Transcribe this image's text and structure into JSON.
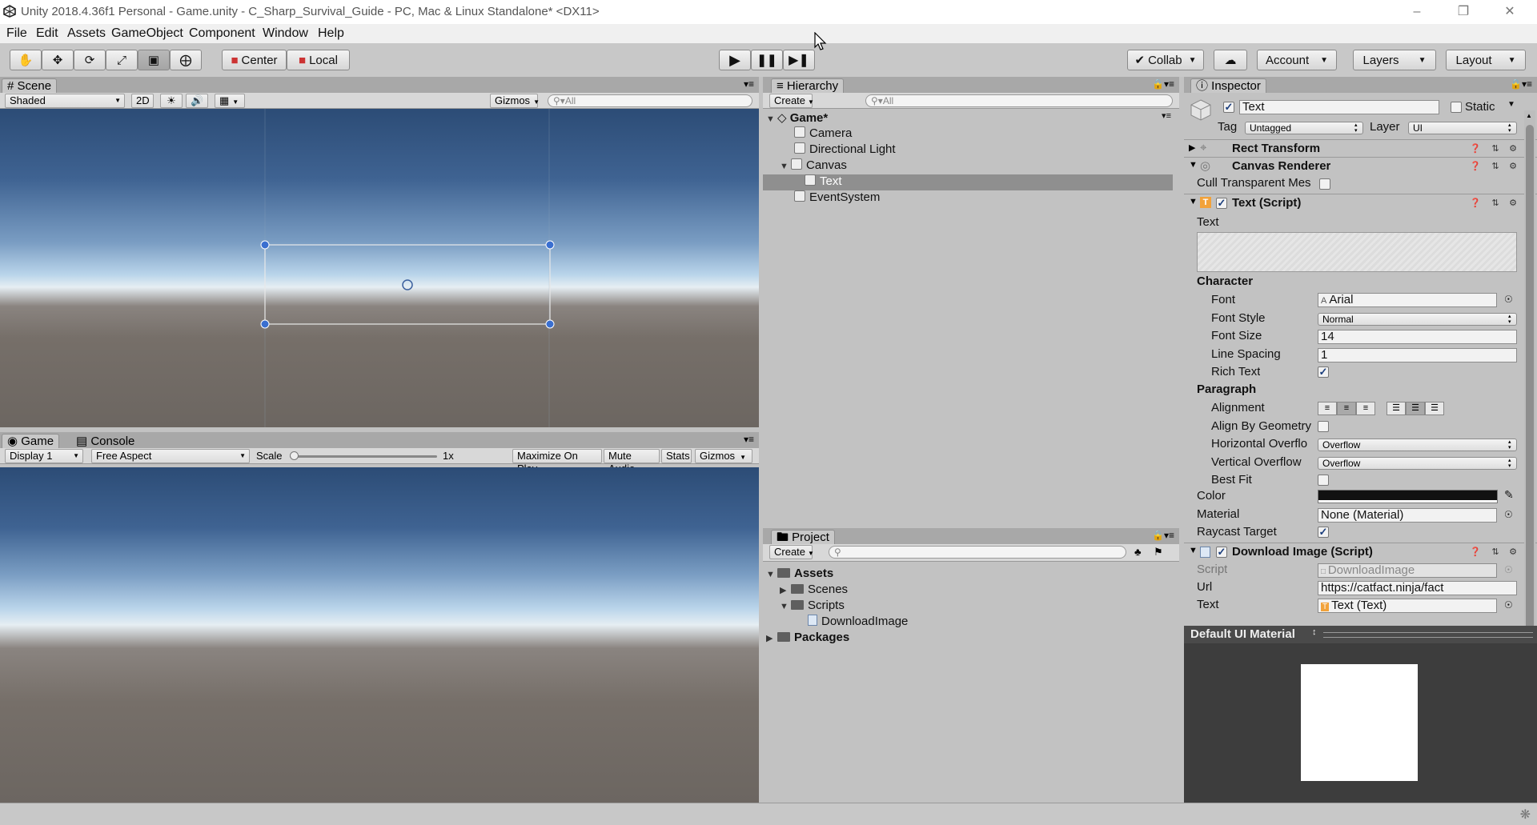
{
  "window": {
    "title": "Unity 2018.4.36f1 Personal - Game.unity - C_Sharp_Survival_Guide - PC, Mac & Linux Standalone* <DX11>"
  },
  "menu": [
    "File",
    "Edit",
    "Assets",
    "GameObject",
    "Component",
    "Window",
    "Help"
  ],
  "toolbar": {
    "pivot": "Center",
    "space": "Local",
    "collab": "Collab",
    "account": "Account",
    "layers": "Layers",
    "layout": "Layout"
  },
  "scene": {
    "tab": "Scene",
    "shading": "Shaded",
    "mode2d": "2D",
    "gizmos": "Gizmos",
    "search_placeholder": "All"
  },
  "game": {
    "tab": "Game",
    "console_tab": "Console",
    "display": "Display 1",
    "aspect": "Free Aspect",
    "scale_label": "Scale",
    "scale_value": "1x",
    "scale_fraction": 0.0,
    "maximize": "Maximize On Play",
    "mute": "Mute Audio",
    "stats": "Stats",
    "gizmos": "Gizmos"
  },
  "hierarchy": {
    "tab": "Hierarchy",
    "create": "Create",
    "search_placeholder": "All",
    "scene_name": "Game*",
    "items": [
      "Camera",
      "Directional Light",
      "Canvas",
      "Text",
      "EventSystem"
    ]
  },
  "project": {
    "tab": "Project",
    "create": "Create",
    "assets": "Assets",
    "scenes": "Scenes",
    "scripts": "Scripts",
    "script_file": "DownloadImage",
    "packages": "Packages"
  },
  "inspector": {
    "tab": "Inspector",
    "object_name": "Text",
    "static_label": "Static",
    "tag_label": "Tag",
    "tag_value": "Untagged",
    "layer_label": "Layer",
    "layer_value": "UI",
    "rect_transform": "Rect Transform",
    "canvas_renderer": "Canvas Renderer",
    "cull_label": "Cull Transparent Mes",
    "text_script": "Text (Script)",
    "text_field_label": "Text",
    "character_header": "Character",
    "font_label": "Font",
    "font_value": "Arial",
    "font_style_label": "Font Style",
    "font_style_value": "Normal",
    "font_size_label": "Font Size",
    "font_size_value": "14",
    "line_spacing_label": "Line Spacing",
    "line_spacing_value": "1",
    "rich_text_label": "Rich Text",
    "paragraph_header": "Paragraph",
    "alignment_label": "Alignment",
    "align_geometry_label": "Align By Geometry",
    "horizontal_overflow_label": "Horizontal Overflo",
    "horizontal_overflow_value": "Overflow",
    "vertical_overflow_label": "Vertical Overflow",
    "vertical_overflow_value": "Overflow",
    "best_fit_label": "Best Fit",
    "color_label": "Color",
    "color_value": "#111111",
    "material_label": "Material",
    "material_value": "None (Material)",
    "raycast_label": "Raycast Target",
    "download_script": "Download Image (Script)",
    "script_label": "Script",
    "script_value": "DownloadImage",
    "url_label": "Url",
    "url_value": "https://catfact.ninja/fact",
    "text_ref_label": "Text",
    "text_ref_value": "Text (Text)",
    "material_preview": "Default UI Material"
  }
}
